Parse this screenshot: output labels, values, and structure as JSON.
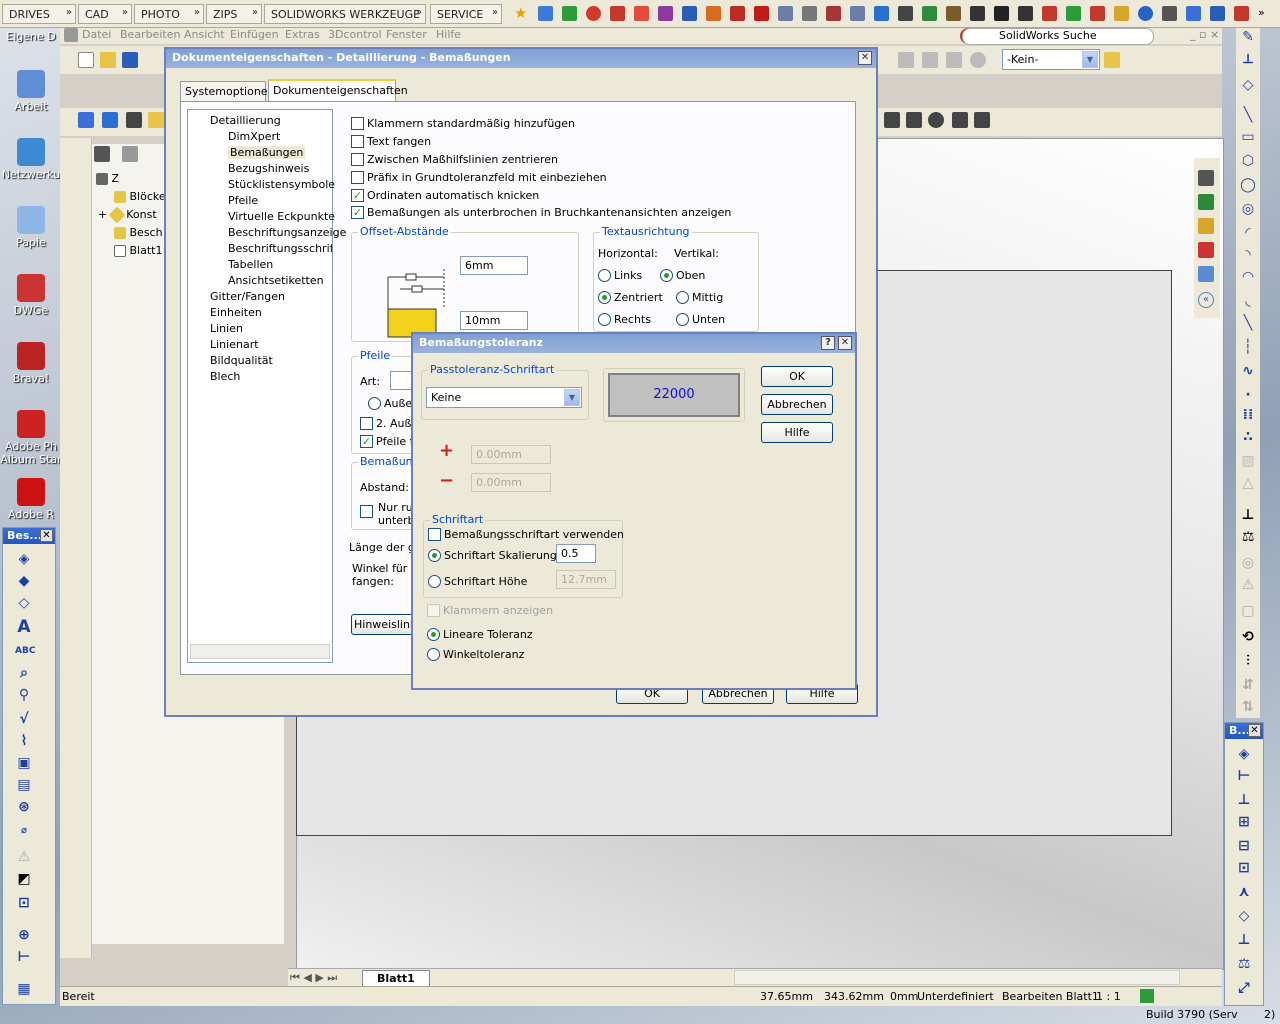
{
  "topbar": {
    "tabs": [
      "DRIVES",
      "CAD",
      "PHOTO",
      "ZIPS",
      "SOLIDWORKS WERKZEUGE",
      "SERVICE"
    ]
  },
  "desktop": {
    "icons": [
      "Eigene D",
      "Arbeit",
      "Netzwerku",
      "Papie",
      "DWGe",
      "Brava!",
      "Adobe Ph Album Star",
      "Adobe R"
    ]
  },
  "sw": {
    "menu": [
      "Datei",
      "Bearbeiten",
      "Ansicht",
      "Einfügen",
      "Extras",
      "3Dcontrol",
      "Fenster",
      "Hilfe"
    ],
    "search_label": "SolidWorks Suche",
    "layer_select": "-Kein-",
    "tree_nodes": [
      "Z",
      "Blöcke",
      "Konst",
      "Besch",
      "Blatt1"
    ],
    "sheet_tab": "Blatt1",
    "status": {
      "state": "Bereit",
      "x": "37.65mm",
      "y": "343.62mm",
      "z": "0mm",
      "def": "Unterdefiniert",
      "edit": "Bearbeiten Blatt1",
      "scale": "1 : 1",
      "build": "Build 3790 (Serv",
      "build_suffix": "2)"
    }
  },
  "left_toolbar": {
    "title": "Bes..."
  },
  "right_toolbar": {
    "title": "B..."
  },
  "doc_dialog": {
    "title": "Dokumenteigenschaften - Detaillierung - Bemaßungen",
    "tabs": [
      "Systemoptionen",
      "Dokumenteigenschaften"
    ],
    "tree": [
      "Detaillierung",
      "DimXpert",
      "Bemaßungen",
      "Bezugshinweis",
      "Stücklistensymbole",
      "Pfeile",
      "Virtuelle Eckpunkte",
      "Beschriftungsanzeige",
      "Beschriftungsschriftar",
      "Tabellen",
      "Ansichtsetiketten",
      "Gitter/Fangen",
      "Einheiten",
      "Linien",
      "Linienart",
      "Bildqualität",
      "Blech"
    ],
    "checks": [
      {
        "label": "Klammern standardmäßig hinzufügen",
        "checked": false
      },
      {
        "label": "Text fangen",
        "checked": false
      },
      {
        "label": "Zwischen Maßhilfslinien zentrieren",
        "checked": false
      },
      {
        "label": "Präfix in Grundtoleranzfeld mit einbeziehen",
        "checked": false
      },
      {
        "label": "Ordinaten automatisch knicken",
        "checked": true
      },
      {
        "label": "Bemaßungen als unterbrochen in Bruchkantenansichten anzeigen",
        "checked": true
      }
    ],
    "offset_title": "Offset-Abstände",
    "offset_1": "6mm",
    "offset_2": "10mm",
    "text_orient_title": "Textausrichtung",
    "horizontal": "Horizontal:",
    "vertical": "Vertikal:",
    "links": "Links",
    "zentriert": "Zentriert",
    "rechts": "Rechts",
    "oben": "Oben",
    "mittig": "Mittig",
    "unten": "Unten",
    "pfeile_title": "Pfeile",
    "art": "Art:",
    "aussen": "Außen",
    "zwei_aussen": "2. Auße",
    "pfeile_fo": "Pfeile fo",
    "bemassungs_title": "Bemaßungs",
    "abstand": "Abstand:",
    "nur_run": "Nur run",
    "unterbr": "unterbr",
    "laenge": "Länge der ge",
    "winkel": "Winkel für ra",
    "fangen": "fangen:",
    "hinweis_btn": "Hinweislinien",
    "ok": "OK",
    "abbrechen": "Abbrechen",
    "hilfe": "Hilfe"
  },
  "tol_dialog": {
    "title": "Bemaßungstoleranz",
    "help_btn": "?",
    "font_group": "Passtoleranz-Schriftart",
    "font_select": "Keine",
    "preview": "22000",
    "plus_value": "0.00mm",
    "minus_value": "0.00mm",
    "schriftart_group": "Schriftart",
    "use_dim_font": "Bemaßungsschriftart verwenden",
    "scale_label": "Schriftart Skalierung",
    "scale_value": "0.5",
    "height_label": "Schriftart Höhe",
    "height_value": "12.7mm",
    "show_brackets": "Klammern anzeigen",
    "linear": "Lineare Toleranz",
    "angular": "Winkeltoleranz",
    "ok": "OK",
    "cancel": "Abbrechen",
    "help": "Hilfe"
  },
  "colors": {
    "accent": "#0046d5",
    "title_bar": "#7f9fd3",
    "check": "#21a121"
  }
}
